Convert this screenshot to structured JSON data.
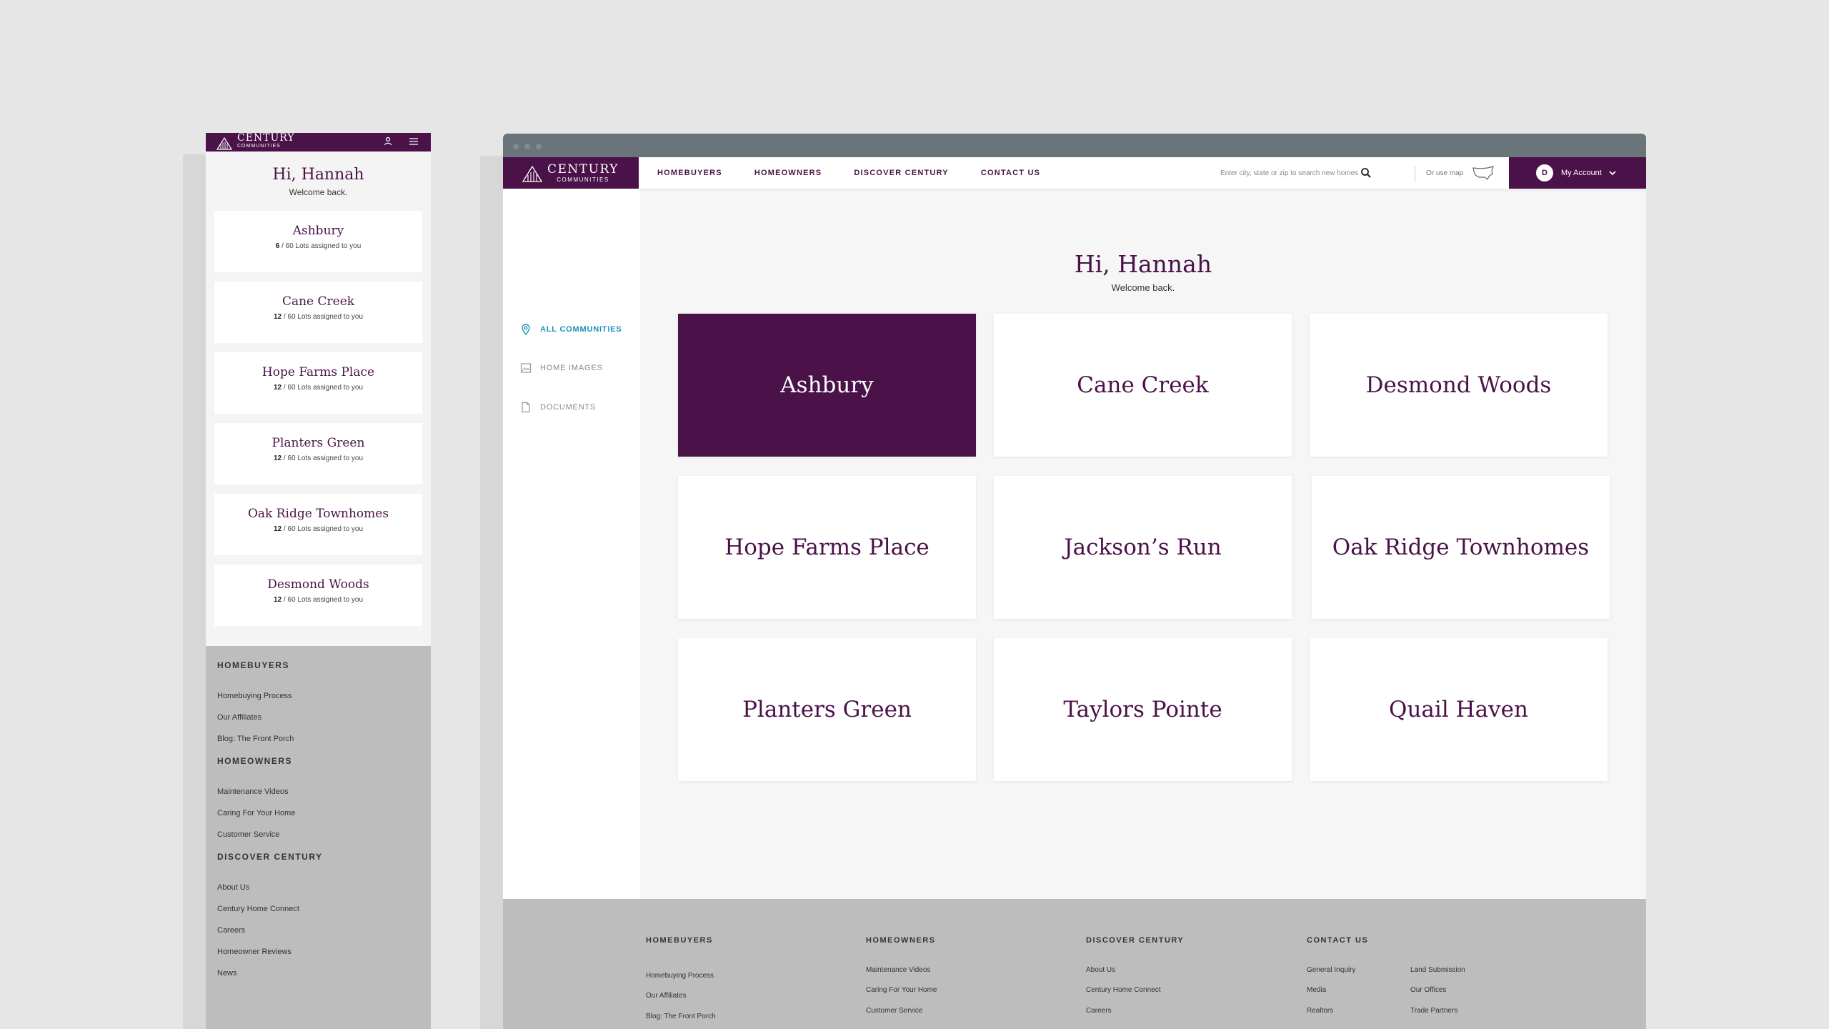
{
  "brand": {
    "name": "CENTURY",
    "sub": "COMMUNITIES",
    "color": "#4a1248"
  },
  "greeting": {
    "title": "Hi, Hannah",
    "subtitle": "Welcome back."
  },
  "mobile": {
    "communities": [
      {
        "name": "Ashbury",
        "assigned": "6",
        "rest": " / 60 Lots assigned to you"
      },
      {
        "name": "Cane Creek",
        "assigned": "12",
        "rest": " / 60 Lots assigned to you"
      },
      {
        "name": "Hope Farms Place",
        "assigned": "12",
        "rest": " / 60 Lots assigned to you"
      },
      {
        "name": "Planters Green",
        "assigned": "12",
        "rest": " / 60 Lots assigned to you"
      },
      {
        "name": "Oak Ridge Townhomes",
        "assigned": "12",
        "rest": " / 60 Lots assigned to you"
      },
      {
        "name": "Desmond Woods",
        "assigned": "12",
        "rest": " / 60 Lots assigned to you"
      }
    ],
    "footer": [
      {
        "heading": "HOMEBUYERS",
        "links": [
          "Homebuying Process",
          "Our Affiliates",
          "Blog: The Front Porch"
        ]
      },
      {
        "heading": "HOMEOWNERS",
        "links": [
          "Maintenance Videos",
          "Caring For Your Home",
          "Customer Service"
        ]
      },
      {
        "heading": "DISCOVER CENTURY",
        "links": [
          "About Us",
          "Century Home Connect",
          "Careers",
          "Homeowner Reviews",
          "News"
        ]
      }
    ]
  },
  "desktop": {
    "nav": [
      "HOMEBUYERS",
      "HOMEOWNERS",
      "DISCOVER CENTURY",
      "CONTACT US"
    ],
    "search_placeholder": "Enter city, state or zip to search new homes",
    "use_map": "Or use map",
    "account": {
      "initial": "D",
      "label": "My Account"
    },
    "sidebar": [
      {
        "label": "ALL COMMUNITIES",
        "icon": "map-pin-icon",
        "active": true
      },
      {
        "label": "HOME IMAGES",
        "icon": "image-icon",
        "active": false
      },
      {
        "label": "DOCUMENTS",
        "icon": "document-icon",
        "active": false
      }
    ],
    "communities": [
      "Ashbury",
      "Cane Creek",
      "Desmond Woods",
      "Hope Farms Place",
      "Jackson’s Run",
      "Oak Ridge Townhomes",
      "Planters Green",
      "Taylors Pointe",
      "Quail Haven"
    ],
    "selected_community": "Ashbury",
    "footer": {
      "homebuyers": {
        "heading": "HOMEBUYERS",
        "links": [
          "Homebuying Process",
          "Our Affiliates",
          "Blog: The Front Porch"
        ]
      },
      "homeowners": {
        "heading": "HOMEOWNERS",
        "links": [
          "Maintenance Videos",
          "Caring For Your Home",
          "Customer Service"
        ]
      },
      "discover": {
        "heading": "DISCOVER CENTURY",
        "links": [
          "About Us",
          "Century Home Connect",
          "Careers"
        ]
      },
      "contact": {
        "heading": "CONTACT US",
        "links_a": [
          "General Inquiry",
          "Media",
          "Realtors"
        ],
        "links_b": [
          "Land Submission",
          "Our Offices",
          "Trade Partners"
        ]
      }
    }
  }
}
